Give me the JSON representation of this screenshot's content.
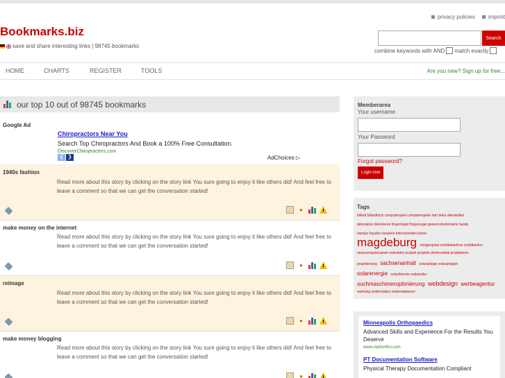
{
  "top_links": {
    "privacy": "privacy policies",
    "imprint": "imprint"
  },
  "logo": "Bookmarks.biz",
  "tagline": "save and share interesting links | 98745 bookmarks",
  "search": {
    "button": "Search",
    "combine_label": "combine keywords with AND",
    "exact_label": "match exactly"
  },
  "nav": {
    "items": [
      "HOME",
      "CHARTS",
      "REGISTER",
      "TOOLS"
    ],
    "signup": "Are you new? Sign up for free..."
  },
  "main": {
    "heading": "our top 10 out of 98745 bookmarks"
  },
  "google_ad": {
    "label": "Google Ad",
    "title": "Chiropractors Near You",
    "description": "Search Top Chiropractors And Book a 100% Free Consultation.",
    "url": "DiscoverChiropractors.com",
    "choices": "AdChoices ▷"
  },
  "stories": [
    {
      "title": "1940s fashion",
      "text": "Read more about this story by clicking on the story link You sure going to enjoy it like others did! And feel free to leave a comment so that we can get the conversation started!"
    },
    {
      "title": "make money on the internet",
      "text": "Read more about this story by clicking on the story link You sure going to enjoy it like others did! And feel free to leave a comment so that we can get the conversation started!"
    },
    {
      "title": "reimage",
      "text": "Read more about this story by clicking on the story link You sure going to enjoy it like others did! And feel free to leave a comment so that we can get the conversation started!"
    },
    {
      "title": "make money blogging",
      "text": "Read more about this story by clicking on the story link You sure going to enjoy it like others did! And feel free to leave a comment so that we can get the conversation started!"
    }
  ],
  "member": {
    "heading": "Memberarea",
    "username_label": "Your username",
    "password_label": "Your Password",
    "forgot": "Forgot password?",
    "login": "Login now"
  },
  "tags": {
    "heading": "Tags",
    "line1": "billard billardtisch computerspiel computerspiele dart deko dekoartikel",
    "line2": "dekoration dekorieren fingernägel fingernagel genericshedomains handy",
    "line3": "handys hausler hausiere internetseiten kicker",
    "big": "magdeburg",
    "big_after": "minijprojekte mobiletelefone mobiltelefon",
    "line5": "neuecomputerspiele osterdeko pcspiel pcspiele photovoltaik projektieren",
    "line6a": "projektierung",
    "line6b": "sachsenanhalt",
    "line6c": "solaranlage solaranlagen",
    "line7a": "solarenergie",
    "line7b": "solarthermie subwoofer",
    "line8a": "suchmaschinenoptimierung",
    "line8b": "webdesign",
    "line8c": "werbeagentur",
    "line9": "werbung weiterstation weiterstationen"
  },
  "side_ads": [
    {
      "title": "Minneapolis Orthopaedics",
      "text": "Advanced Skills and Experience For the Results You Deserve",
      "url": "www.mplsortho.com"
    },
    {
      "title": "PT Documentation Software",
      "text": "Physical Therapy Documentation Compliant"
    }
  ],
  "colors": {
    "brand": "#cc0000",
    "story_bg": "#fdf3df",
    "signup": "#2a8a2a"
  }
}
